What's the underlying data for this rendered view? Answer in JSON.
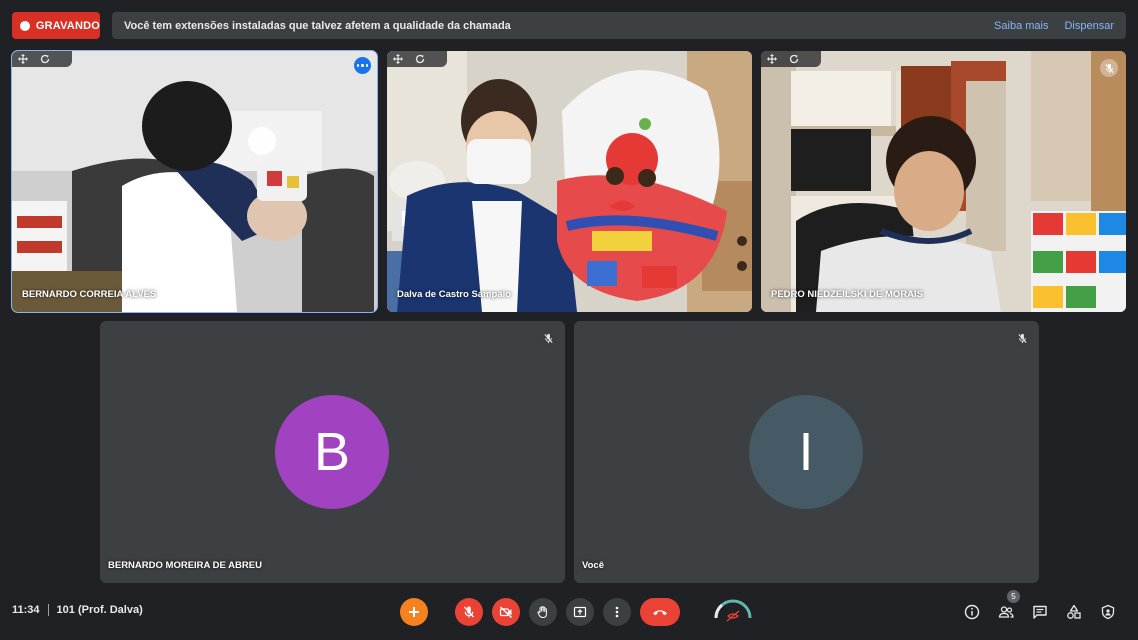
{
  "recording": {
    "label": "GRAVANDO"
  },
  "banner": {
    "message": "Você tem extensões instaladas que talvez afetem a qualidade da chamada",
    "learn_more": "Saiba mais",
    "dismiss": "Dispensar"
  },
  "participants": [
    {
      "name": "BERNARDO CORREIA ALVES",
      "type": "video",
      "active_speaker": true
    },
    {
      "name": "Dalva de Castro Sampaio",
      "type": "video"
    },
    {
      "name": "PEDRO NIEDZEILSKI DE MORAIS",
      "type": "video",
      "muted": true
    },
    {
      "name": "BERNARDO MOREIRA DE ABREU",
      "type": "avatar",
      "initial": "B",
      "avatar_color": "#a142c0",
      "muted": true
    },
    {
      "name": "Você",
      "type": "avatar",
      "initial": "I",
      "avatar_color": "#455a64",
      "muted": true
    }
  ],
  "footer": {
    "time": "11:34",
    "meeting_name": "101 (Prof. Dalva)",
    "participant_count": "5"
  },
  "icons": {
    "add": "plus-icon",
    "mic": "mic-off-icon",
    "camera": "camera-off-icon",
    "hand": "raise-hand-icon",
    "present": "present-icon",
    "more": "more-vert-icon",
    "hangup": "hangup-icon",
    "info": "info-icon",
    "people": "people-icon",
    "chat": "chat-icon",
    "activities": "activities-icon",
    "safety": "host-controls-icon"
  }
}
